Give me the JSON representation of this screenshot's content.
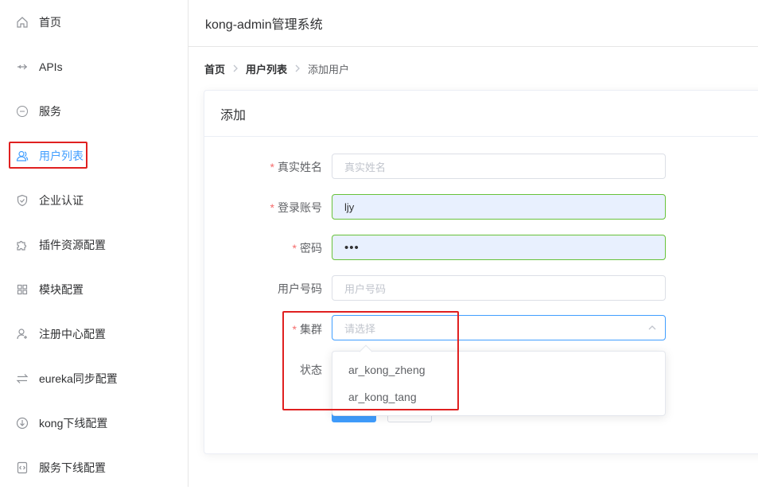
{
  "sidebar": {
    "items": [
      {
        "label": "首页",
        "icon": "home-icon"
      },
      {
        "label": "APIs",
        "icon": "api-icon"
      },
      {
        "label": "服务",
        "icon": "service-icon"
      },
      {
        "label": "用户列表",
        "icon": "user-icon",
        "active": true
      },
      {
        "label": "企业认证",
        "icon": "shield-check-icon"
      },
      {
        "label": "插件资源配置",
        "icon": "puzzle-icon"
      },
      {
        "label": "模块配置",
        "icon": "grid-icon"
      },
      {
        "label": "注册中心配置",
        "icon": "user-plus-icon"
      },
      {
        "label": "eureka同步配置",
        "icon": "sync-arrows-icon"
      },
      {
        "label": "kong下线配置",
        "icon": "download-circle-icon"
      },
      {
        "label": "服务下线配置",
        "icon": "code-file-icon"
      }
    ]
  },
  "header": {
    "title": "kong-admin管理系统"
  },
  "breadcrumb": {
    "home": "首页",
    "list": "用户列表",
    "current": "添加用户"
  },
  "card": {
    "title": "添加"
  },
  "form": {
    "real_name": {
      "label": "真实姓名",
      "placeholder": "真实姓名",
      "value": ""
    },
    "account": {
      "label": "登录账号",
      "value": "ljy"
    },
    "password": {
      "label": "密码",
      "value": "•••"
    },
    "user_number": {
      "label": "用户号码",
      "placeholder": "用户号码",
      "value": ""
    },
    "cluster": {
      "label": "集群",
      "placeholder": "请选择",
      "options": [
        "ar_kong_zheng",
        "ar_kong_tang"
      ]
    },
    "status": {
      "label": "状态"
    }
  },
  "colors": {
    "accent": "#409eff",
    "required": "#f56c6c",
    "highlight": "#e02020",
    "valid": "#67c23a"
  }
}
